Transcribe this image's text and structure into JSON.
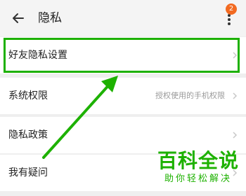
{
  "header": {
    "title": "隐私",
    "back_icon": "back-arrow-icon",
    "more_icon": "more-vertical-icon",
    "badge_count": "2"
  },
  "rows": [
    {
      "label": "好友隐私设置",
      "value": ""
    },
    {
      "label": "系统权限",
      "value": "授权使用的手机权限"
    },
    {
      "label": "隐私政策",
      "value": ""
    },
    {
      "label": "我有疑问",
      "value": ""
    }
  ],
  "watermark": {
    "main": "百科全说",
    "sub": "助你轻松解决"
  },
  "colors": {
    "accent_green": "#1db100",
    "badge_orange": "#f26a21",
    "background": "#efefef"
  }
}
